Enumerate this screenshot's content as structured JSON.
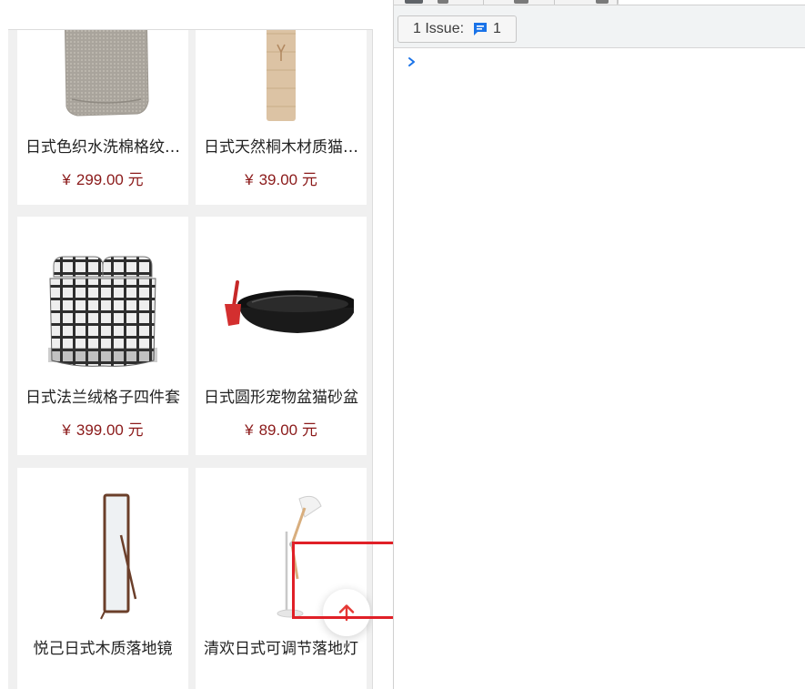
{
  "products": [
    {
      "name": "日式色织水洗棉格纹…",
      "price": "299.00 元",
      "image_icon": "grey-quilt-image"
    },
    {
      "name": "日式天然桐木材质猫…",
      "price": "39.00 元",
      "image_icon": "wooden-cat-scratcher-image"
    },
    {
      "name": "日式法兰绒格子四件套",
      "price": "399.00 元",
      "image_icon": "plaid-bedding-set-image"
    },
    {
      "name": "日式圆形宠物盆猫砂盆",
      "price": "89.00 元",
      "image_icon": "black-litter-box-image"
    },
    {
      "name": "悦己日式木质落地镜",
      "price": "",
      "image_icon": "floor-mirror-image"
    },
    {
      "name": "清欢日式可调节落地灯",
      "price": "",
      "image_icon": "floor-lamp-image"
    }
  ],
  "price_symbol": "¥",
  "back_to_top_icon": "arrow-up-icon",
  "devtools": {
    "issues_label": "1 Issue:",
    "issues_count": "1",
    "issues_icon": "message-icon",
    "prompt_icon": "chevron-right-icon"
  },
  "colors": {
    "price": "#8b1a1a",
    "accent": "#e53935",
    "highlight": "#e02027",
    "devtools_blue": "#1a73e8"
  }
}
